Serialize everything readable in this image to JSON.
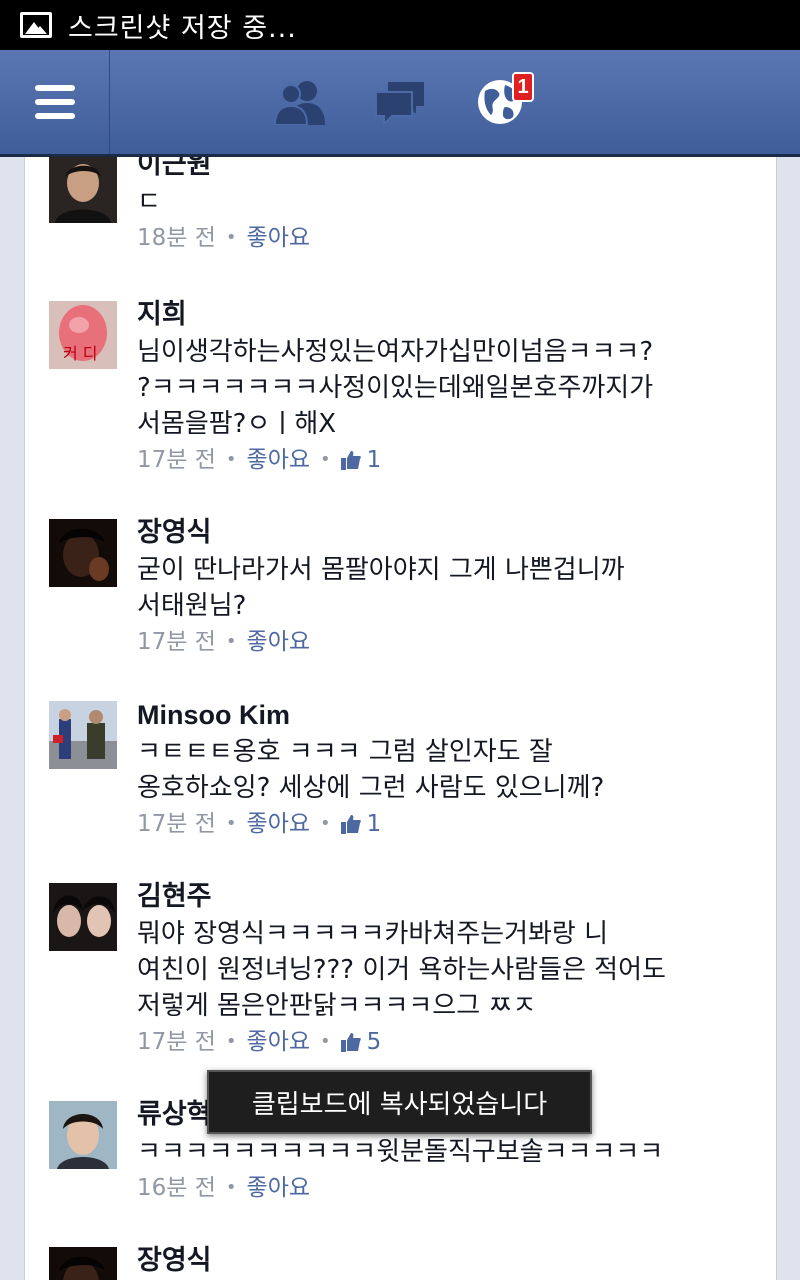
{
  "status": {
    "text": "스크린샷 저장 중..."
  },
  "nav": {
    "notification_count": "1"
  },
  "comments": [
    {
      "name": "이근원",
      "text": "ㄷ",
      "time": "18분 전",
      "like": "좋아요",
      "likes": null
    },
    {
      "name": "지희",
      "text": "님이생각하는사정있는여자가십만이넘음ㅋㅋㅋ?\n?ㅋㅋㅋㅋㅋㅋㅋ사정이있는데왜일본호주까지가\n서몸을팜?ㅇㅣ해X",
      "time": "17분 전",
      "like": "좋아요",
      "likes": "1"
    },
    {
      "name": "장영식",
      "text": "굳이 딴나라가서 몸팔아야지 그게 나쁜겁니까\n서태원님?",
      "time": "17분 전",
      "like": "좋아요",
      "likes": null
    },
    {
      "name": "Minsoo Kim",
      "text": "ㅋㅌㅌㅌ옹호 ㅋㅋㅋ 그럼 살인자도 잘\n옹호하쇼잉? 세상에 그런 사람도 있으니께?",
      "time": "17분 전",
      "like": "좋아요",
      "likes": "1"
    },
    {
      "name": "김현주",
      "text": "뭐야 장영식ㅋㅋㅋㅋㅋ카바쳐주는거봐랑 니\n여친이 원정녀닝??? 이거 욕하는사람들은 적어도\n저렇게 몸은안판닭ㅋㅋㅋㅋ으그 ㅉㅈ",
      "time": "17분 전",
      "like": "좋아요",
      "likes": "5"
    },
    {
      "name": "류상혁",
      "text": "ㅋㅋㅋㅋㅋㅋㅋㅋㅋㅋ윗분돌직구보솔ㅋㅋㅋㅋㅋ",
      "time": "16분 전",
      "like": "좋아요",
      "likes": null
    },
    {
      "name": "장영식",
      "text": "",
      "time": "",
      "like": "",
      "likes": null
    }
  ],
  "toast": {
    "text": "클립보드에 복사되었습니다"
  }
}
